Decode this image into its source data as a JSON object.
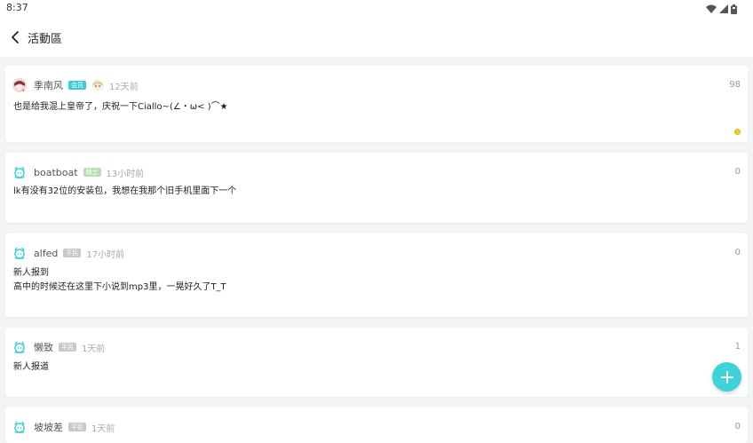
{
  "status_bar": {
    "time": "8:37"
  },
  "app_bar": {
    "title": "活動區"
  },
  "posts": [
    {
      "username": "季南风",
      "badge": "会员",
      "badge_color": "#3fc9d6",
      "time": "12天前",
      "count": "98",
      "content": [
        "也是给我混上皇帝了，庆祝一下Ciallo~(∠・ω< )⌒★"
      ]
    },
    {
      "username": "boatboat",
      "badge": "骑士",
      "badge_color": "#b9dfae",
      "time": "13小时前",
      "count": "0",
      "content": [
        "lk有没有32位的安装包，我想在我那个旧手机里面下一个"
      ]
    },
    {
      "username": "alfed",
      "badge": "平民",
      "badge_color": "#c8c8c8",
      "time": "17小时前",
      "count": "0",
      "content": [
        "新人报到",
        "高中的时候还在这里下小说到mp3里，一晃好久了T_T"
      ]
    },
    {
      "username": "懒致",
      "badge": "平民",
      "badge_color": "#c8c8c8",
      "time": "1天前",
      "count": "1",
      "content": [
        "新人报道"
      ]
    },
    {
      "username": "坡坡差",
      "badge": "平民",
      "badge_color": "#c8c8c8",
      "time": "1天前",
      "count": "0",
      "content": []
    }
  ]
}
